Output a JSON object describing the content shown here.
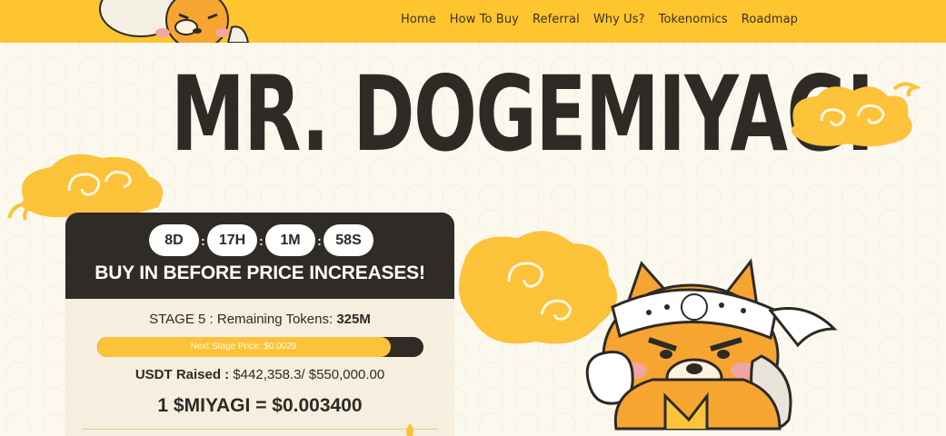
{
  "colors": {
    "accent": "#fec52e",
    "dark": "#2f2b26",
    "background": "#fbf8ee",
    "progress": "#fcc23a"
  },
  "nav": {
    "links": [
      "Home",
      "How To Buy",
      "Referral",
      "Why Us?",
      "Tokenomics",
      "Roadmap"
    ]
  },
  "hero": {
    "title": "MR. DOGEMIYAGI"
  },
  "presale": {
    "countdown": {
      "days": "8D",
      "hours": "17H",
      "minutes": "1M",
      "seconds": "58S",
      "separator": ":"
    },
    "heading": "BUY IN BEFORE PRICE INCREASES!",
    "stage_label": "STAGE 5 : Remaining Tokens: ",
    "remaining_tokens": "325M",
    "progress_fraction": 0.9,
    "next_stage_price": "Next Stage Price: $0.0029",
    "raised_label": "USDT Raised : ",
    "raised_value": "$442,358.3/ $550,000.00",
    "price_line": "1 $MIYAGI = $0.003400"
  },
  "icons": [
    "dog-mascot-icon",
    "cloud-icon",
    "fire-icon"
  ]
}
